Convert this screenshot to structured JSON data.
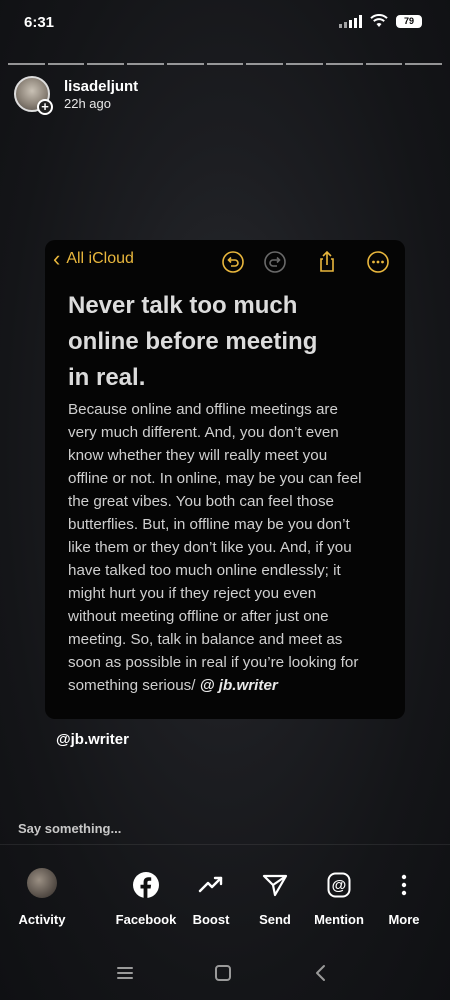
{
  "status_bar": {
    "time": "6:31",
    "battery": "79",
    "icons": [
      "signal-icon",
      "wifi-icon",
      "battery-icon"
    ]
  },
  "story": {
    "segments_total": 11,
    "segments_viewed": 0,
    "username": "lisadeljunt",
    "posted": "22h ago"
  },
  "note": {
    "back_label": "All iCloud",
    "toolbar_icons": [
      "undo-icon",
      "redo-icon",
      "share-icon",
      "more-icon"
    ],
    "accent": "#e9b73d",
    "title_lines": [
      "Never talk too much",
      "online before meeting",
      "in real."
    ],
    "body_lines": [
      "Because online and offline meetings are",
      "very much different. And, you don’t even",
      "know whether they will really meet you",
      "offline or not. In online, may be you can feel",
      "the great vibes. You both can feel those",
      "butterflies. But, in offline may be you don’t",
      "like them or they don’t like you. And, if you",
      "have talked too much online endlessly; it",
      "might hurt you if they reject you even",
      "without meeting offline or after just one",
      "meeting. So, talk in balance and meet as",
      "soon as possible in real if you’re looking for"
    ],
    "body_last_line": "something serious/ ",
    "body_handle": "@ jb.writer"
  },
  "caption": "@jb.writer",
  "reply": {
    "placeholder": "Say something..."
  },
  "actions": {
    "activity": "Activity",
    "facebook": "Facebook",
    "boost": "Boost",
    "send": "Send",
    "mention": "Mention",
    "more": "More"
  },
  "nav": [
    "recents-icon",
    "home-icon",
    "back-icon"
  ]
}
